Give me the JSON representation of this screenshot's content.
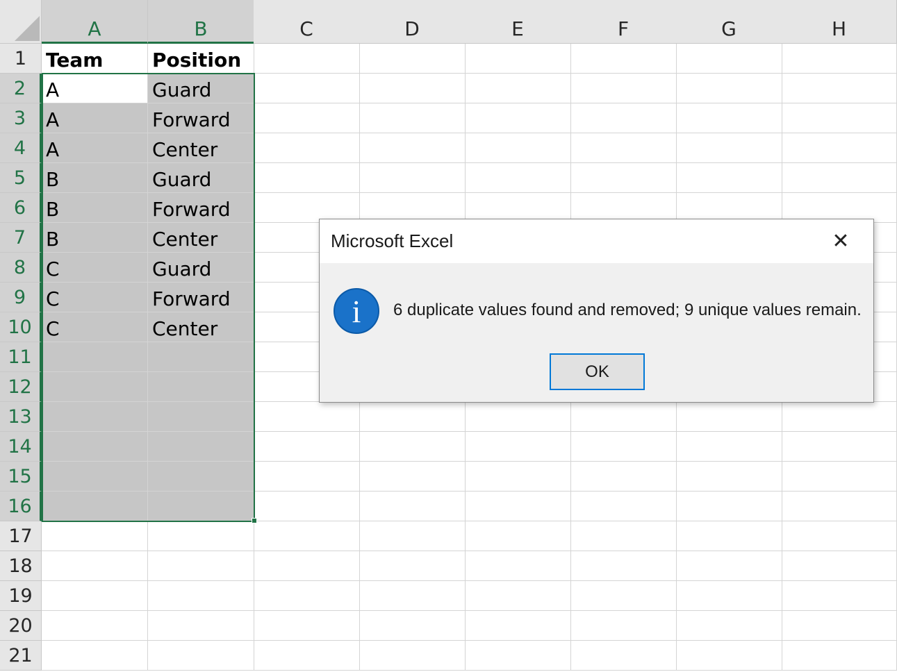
{
  "spreadsheet": {
    "columns": [
      "A",
      "B",
      "C",
      "D",
      "E",
      "F",
      "G",
      "H"
    ],
    "rows": [
      "1",
      "2",
      "3",
      "4",
      "5",
      "6",
      "7",
      "8",
      "9",
      "10",
      "11",
      "12",
      "13",
      "14",
      "15",
      "16",
      "17",
      "18",
      "19",
      "20",
      "21"
    ],
    "cells": {
      "A1": "Team",
      "B1": "Position",
      "A2": "A",
      "B2": "Guard",
      "A3": "A",
      "B3": "Forward",
      "A4": "A",
      "B4": "Center",
      "A5": "B",
      "B5": "Guard",
      "A6": "B",
      "B6": "Forward",
      "A7": "B",
      "B7": "Center",
      "A8": "C",
      "B8": "Guard",
      "A9": "C",
      "B9": "Forward",
      "A10": "C",
      "B10": "Center"
    },
    "selected_range": "A2:B16",
    "active_cell": "A2",
    "bold_row": "1",
    "accent_color": "#217346",
    "selection_fill_color": "#c6c6c6"
  },
  "dialog": {
    "title": "Microsoft Excel",
    "close_symbol": "✕",
    "icon": "info-icon",
    "icon_glyph": "i",
    "message": "6 duplicate values found and removed; 9 unique values remain.",
    "ok_label": "OK"
  }
}
